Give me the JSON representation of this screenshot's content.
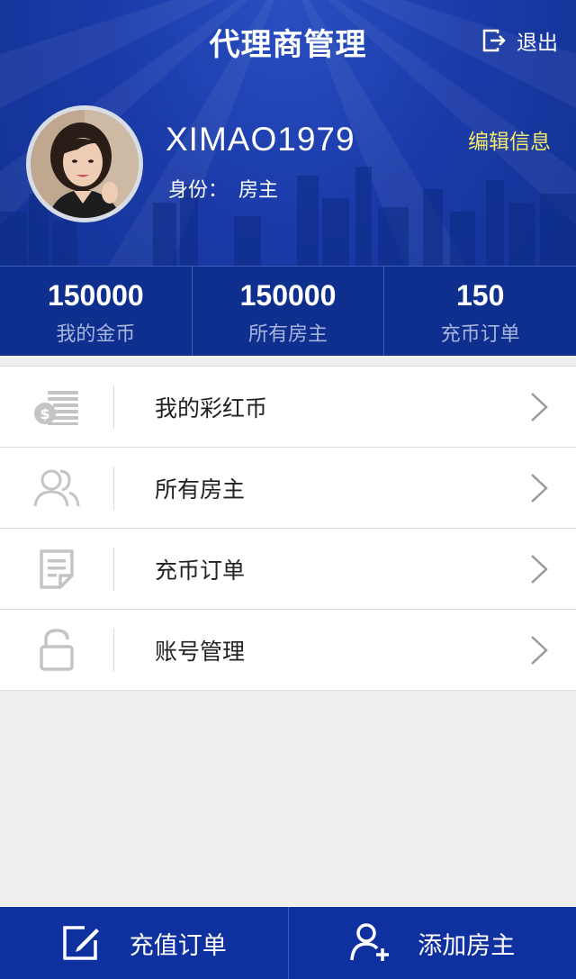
{
  "header": {
    "title": "代理商管理",
    "logout_label": "退出",
    "username": "XIMAO1979",
    "role_label": "身份：",
    "role_value": "房主",
    "edit_label": "编辑信息"
  },
  "stats": [
    {
      "value": "150000",
      "label": "我的金币"
    },
    {
      "value": "150000",
      "label": "所有房主"
    },
    {
      "value": "150",
      "label": "充币订单"
    }
  ],
  "menu": [
    {
      "label": "我的彩红币",
      "icon": "coins-icon"
    },
    {
      "label": "所有房主",
      "icon": "users-icon"
    },
    {
      "label": "充币订单",
      "icon": "document-icon"
    },
    {
      "label": "账号管理",
      "icon": "unlock-icon"
    }
  ],
  "bottom_bar": {
    "left_label": "充值订单",
    "left_icon": "edit-icon",
    "right_label": "添加房主",
    "right_icon": "add-user-icon"
  },
  "colors": {
    "header_bg": "#1a3aa8",
    "stats_bg": "#0f2f8e",
    "bottom_bar_bg": "#0f31a0",
    "edit_accent": "#f3e96b",
    "icon_gray": "#c4c4c4"
  }
}
